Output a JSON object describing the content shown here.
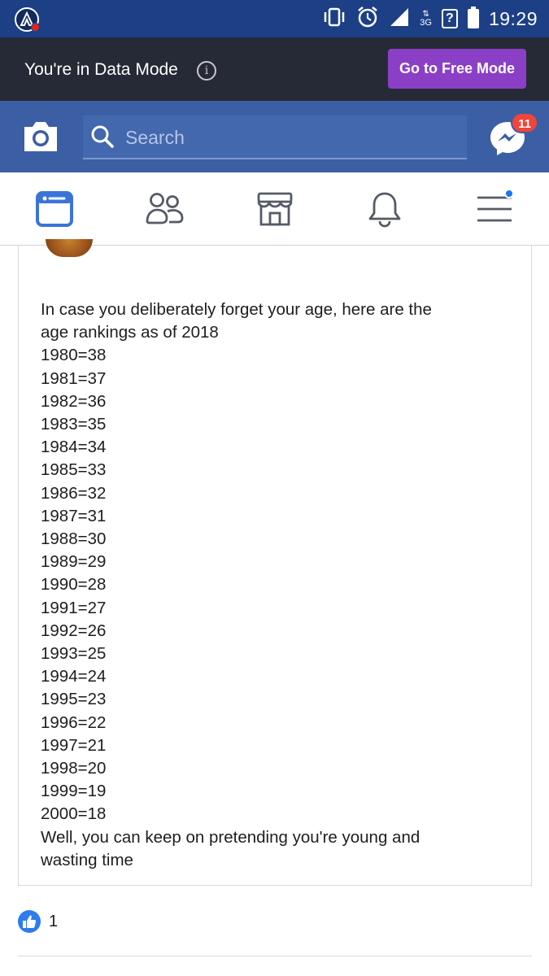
{
  "status_bar": {
    "network": "3G",
    "unknown": "?",
    "time": "19:29"
  },
  "data_mode": {
    "text": "You're in Data Mode",
    "info": "i",
    "button": "Go to Free Mode"
  },
  "header": {
    "search_placeholder": "Search",
    "messenger_badge": "11"
  },
  "nav": {
    "tabs": [
      "news-feed",
      "friends",
      "marketplace",
      "notifications",
      "menu"
    ]
  },
  "post": {
    "intro_line1": "In case you deliberately forget your age, here are the",
    "intro_line2": "age rankings as of 2018",
    "rankings": [
      "1980=38",
      "1981=37",
      "1982=36",
      "1983=35",
      "1984=34",
      "1985=33",
      "1986=32",
      "1987=31",
      "1988=30",
      "1989=29",
      "1990=28",
      "1991=27",
      "1992=26",
      "1993=25",
      "1994=24",
      "1995=23",
      "1996=22",
      "1997=21",
      "1998=20",
      "1999=19",
      "2000=18"
    ],
    "outro_line1": "Well, you can keep on pretending you're young and",
    "outro_line2": "wasting time"
  },
  "reactions": {
    "like_count": "1"
  },
  "colors": {
    "status_bar": "#1c3f86",
    "data_mode_bar": "#262a36",
    "free_mode_button": "#8b3fc6",
    "header": "#3b5ea4",
    "badge": "#f0453a",
    "like": "#2f7ced"
  }
}
